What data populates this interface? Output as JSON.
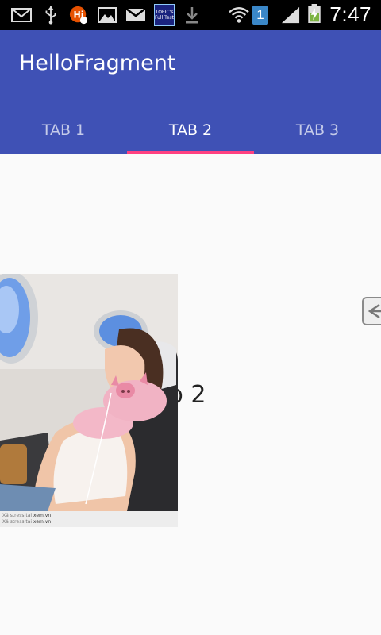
{
  "status_bar": {
    "time": "7:47",
    "notification_count": "1",
    "icons": [
      "mail-icon",
      "usb-icon",
      "app-notification-icon",
      "image-icon",
      "gmail-icon",
      "toeic-app-icon",
      "download-icon",
      "wifi-icon",
      "sim-icon",
      "signal-icon",
      "battery-charging-icon"
    ],
    "toeic_label": "TOEIC's\nFull Test"
  },
  "app_bar": {
    "title": "HelloFragment",
    "color": "#3f51b5"
  },
  "tabs": [
    {
      "label": "TAB 1",
      "selected": false
    },
    {
      "label": "TAB 2",
      "selected": true
    },
    {
      "label": "TAB 3",
      "selected": false
    }
  ],
  "indicator_color": "#ff4081",
  "content": {
    "text": "Tab 2",
    "photo_caption_line1": "Xả stress tại",
    "photo_caption_site1": "xem.vn",
    "photo_caption_line2": "Xả stress tại",
    "photo_caption_site2": "xem.vn"
  }
}
